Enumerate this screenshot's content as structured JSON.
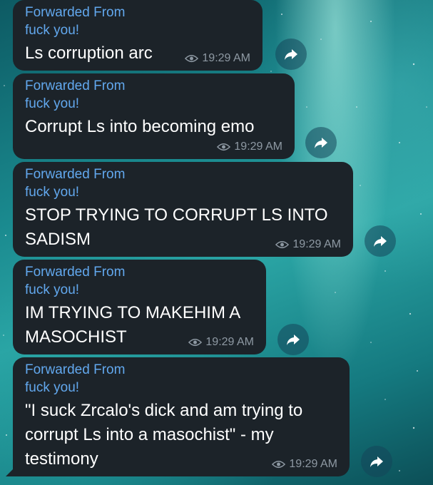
{
  "messages": [
    {
      "forwarded_label": "Forwarded From",
      "sender": "fuck you!",
      "text": "Ls corruption arc",
      "time": "19:29 AM"
    },
    {
      "forwarded_label": "Forwarded From",
      "sender": "fuck you!",
      "text": "Corrupt Ls into becoming emo",
      "time": "19:29 AM"
    },
    {
      "forwarded_label": "Forwarded From",
      "sender": "fuck you!",
      "text": "STOP TRYING TO CORRUPT LS INTO SADISM",
      "time": "19:29 AM"
    },
    {
      "forwarded_label": "Forwarded From",
      "sender": "fuck you!",
      "text": "IM TRYING TO MAKEHIM A MASOCHIST",
      "time": "19:29 AM"
    },
    {
      "forwarded_label": "Forwarded From",
      "sender": "fuck you!",
      "text": "\"I suck Zrcalo's dick and am trying to corrupt Ls into a masochist\" - my testimony",
      "time": "19:29 AM"
    }
  ],
  "colors": {
    "bubble": "#1c2329",
    "link": "#62a8ee",
    "meta": "#8e99a3"
  },
  "icons": {
    "views": "eye-icon",
    "share": "share-arrow-icon"
  }
}
